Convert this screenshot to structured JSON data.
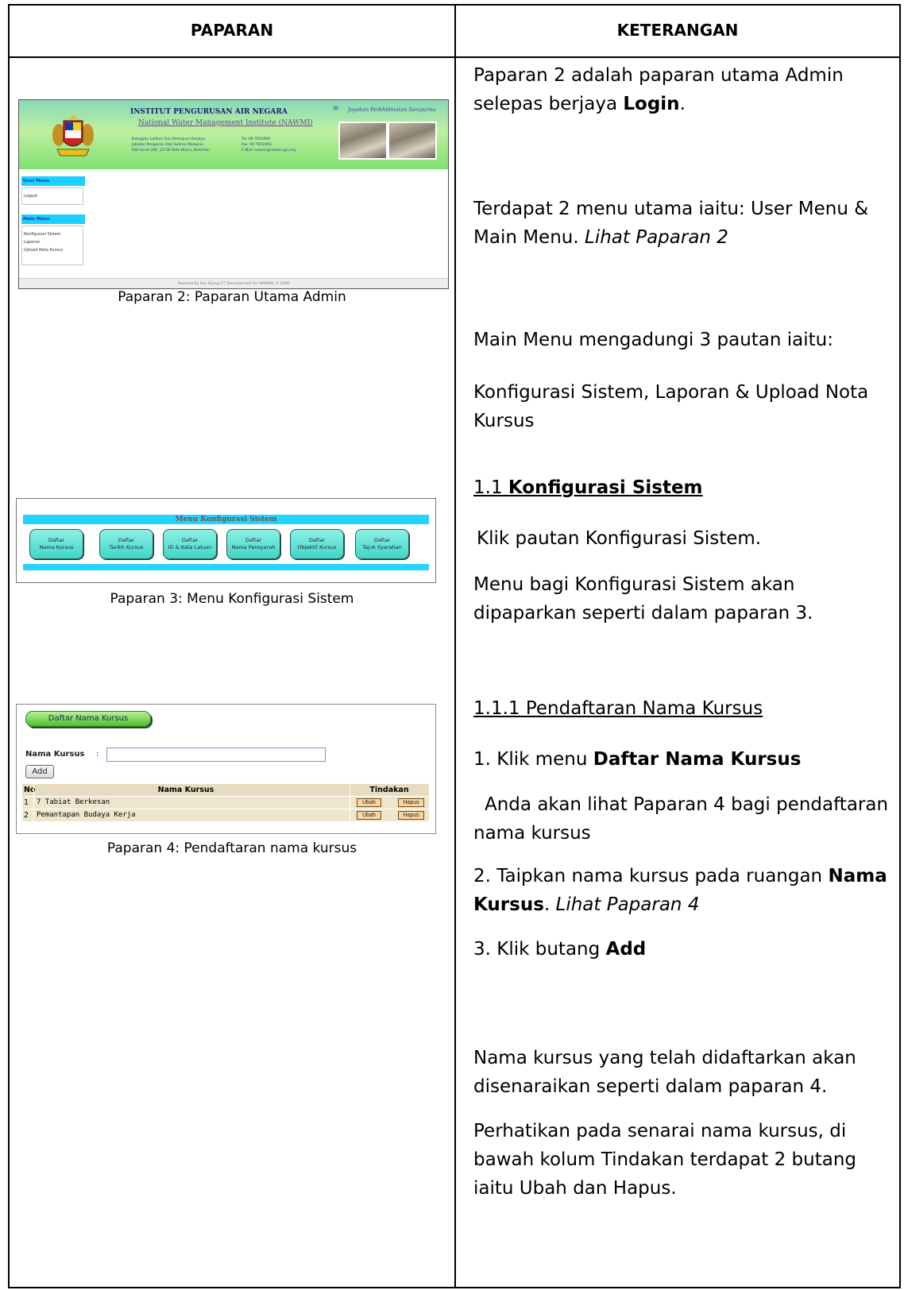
{
  "table": {
    "header_left": "PAPARAN",
    "header_right": "KETERANGAN"
  },
  "captions": {
    "shot1": "Paparan 2: Paparan Utama Admin",
    "shot2": "Paparan 3: Menu Konfigurasi Sistem",
    "shot3": "Paparan 4: Pendaftaran nama kursus"
  },
  "notes": {
    "p1_a": "Paparan 2 adalah paparan utama Admin selepas berjaya ",
    "p1_bold": "Login",
    "p1_end": ".",
    "p2_a": "Terdapat 2 menu utama iaitu: User Menu & Main Menu. ",
    "p2_italic": "Lihat Paparan 2",
    "p3": "Main Menu mengadungi 3 pautan iaitu:",
    "p4": "Konfigurasi Sistem, Laporan & Upload Nota Kursus",
    "s11_num": "1.1 ",
    "s11_title": "Konfigurasi Sistem",
    "p5": "Klik pautan Konfigurasi Sistem.",
    "p6": "Menu bagi Konfigurasi Sistem akan dipaparkan seperti dalam paparan 3.",
    "s111": "1.1.1 Pendaftaran Nama Kursus",
    "p7_a": "1. Klik menu ",
    "p7_bold": "Daftar Nama Kursus",
    "p8": "Anda akan lihat Paparan 4 bagi pendaftaran nama kursus",
    "p9_a": "2. Taipkan nama kursus pada ruangan ",
    "p9_bold": "Nama Kursus",
    "p9_b": ". ",
    "p9_italic": "Lihat Paparan 4",
    "p10_a": "3. Klik butang ",
    "p10_bold": "Add",
    "p11": "Nama kursus yang telah didaftarkan akan disenaraikan seperti dalam paparan 4.",
    "p12": "Perhatikan pada senarai nama kursus, di bawah kolum Tindakan terdapat 2 butang iaitu Ubah dan Hapus."
  },
  "shot1": {
    "org_name": "INSTITUT PENGURUSAN AIR NEGARA",
    "org_name_en": "National Water Management Institute (NAWMI)",
    "addr_lines": [
      "Bahagian Latihan Dan Kemajuan Kerjaya",
      "Jabatan Pengairan Dan Saliran Malaysia",
      "Peti Surat 246, 15730 Kota Bharu, Kelantan"
    ],
    "contact_lines": [
      "Tel: 09 7652690",
      "Fax: 09 7651993",
      "E-Mail: nawmi@nawmi.gov.my"
    ],
    "slogan": "Jayakan Perkhidmatan Sempurna",
    "user_menu_title": "User Menu",
    "user_menu_items": [
      "Logout"
    ],
    "main_menu_title": "Main Menu",
    "main_menu_items": [
      "Konfigurasi Sistem",
      "Laporan",
      "Upload Nota Kursus"
    ],
    "footer": "Powered By Seri Kijang ICT Development For (NAWMI) © 2006"
  },
  "shot2": {
    "title": "Menu Konfigurasi Sistem",
    "buttons": [
      {
        "line1": "Daftar",
        "line2": "Nama Kursus"
      },
      {
        "line1": "Daftar",
        "line2": "Tarikh Kursus"
      },
      {
        "line1": "Daftar",
        "line2": "ID & Kata Laluan"
      },
      {
        "line1": "Daftar",
        "line2": "Nama Pensyarah"
      },
      {
        "line1": "Daftar",
        "line2": "Objektif Kursus"
      },
      {
        "line1": "Daftar",
        "line2": "Tajuk Syarahan"
      }
    ]
  },
  "shot3": {
    "pill_label": "Daftar Nama Kursus",
    "field_label": "Nama Kursus",
    "field_colon": ":",
    "field_value": "",
    "add_label": "Add",
    "columns": [
      "No",
      "Nama Kursus",
      "Tindakan"
    ],
    "rows": [
      {
        "no": "1",
        "name": "7 Tabiat Berkesan",
        "edit": "Ubah",
        "delete": "Hapus"
      },
      {
        "no": "2",
        "name": "Pemantapan Budaya Kerja",
        "edit": "Ubah",
        "delete": "Hapus"
      }
    ]
  },
  "colors": {
    "menu_bar": "#22d4ff",
    "button_teal": "#3ed6c6",
    "pill_green": "#4cc02c",
    "table_row": "#ede6cc"
  }
}
